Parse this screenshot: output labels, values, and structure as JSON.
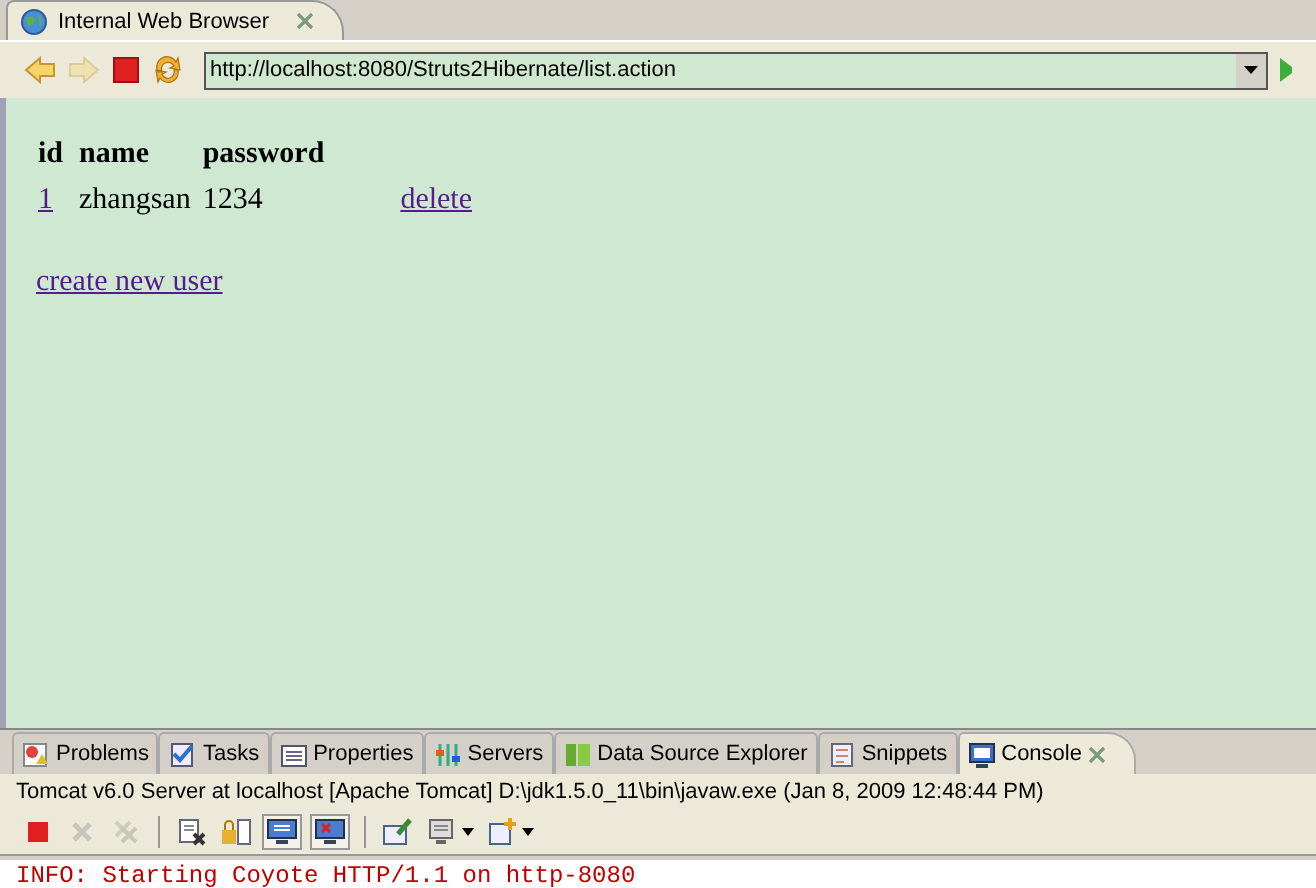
{
  "editor_tab": {
    "title": "Internal Web Browser",
    "selected": true
  },
  "browser_toolbar": [
    {
      "kind": "back",
      "disabled": false
    },
    {
      "kind": "forward",
      "disabled": true
    },
    {
      "kind": "stop",
      "disabled": false
    },
    {
      "kind": "refresh",
      "disabled": false
    }
  ],
  "address": {
    "value": "http://localhost:8080/Struts2Hibernate/list.action"
  },
  "page": {
    "table": {
      "columns": [
        "id",
        "name",
        "password"
      ],
      "rows": [
        {
          "id": "1",
          "name": "zhangsan",
          "password": "1234",
          "action": "delete"
        }
      ]
    },
    "create_link": "create new user"
  },
  "bottom_tabs": [
    {
      "label": "Problems",
      "selected": false
    },
    {
      "label": "Tasks",
      "selected": false
    },
    {
      "label": "Properties",
      "selected": false
    },
    {
      "label": "Servers",
      "selected": false
    },
    {
      "label": "Data Source Explorer",
      "selected": false
    },
    {
      "label": "Snippets",
      "selected": false
    },
    {
      "label": "Console",
      "selected": true
    }
  ],
  "console": {
    "title": "Tomcat v6.0 Server at localhost [Apache Tomcat] D:\\jdk1.5.0_11\\bin\\javaw.exe (Jan 8, 2009 12:48:44 PM)",
    "toolbar": [
      {
        "kind": "terminate",
        "disabled": false,
        "selected": false
      },
      {
        "kind": "remove",
        "disabled": true,
        "selected": false
      },
      {
        "kind": "remove-all",
        "disabled": true,
        "selected": false
      },
      {
        "kind": "separator"
      },
      {
        "kind": "clear",
        "disabled": false,
        "selected": false
      },
      {
        "kind": "scroll-lock",
        "disabled": false,
        "selected": false
      },
      {
        "kind": "stdout",
        "disabled": false,
        "selected": true
      },
      {
        "kind": "stderr",
        "disabled": false,
        "selected": true
      },
      {
        "kind": "separator"
      },
      {
        "kind": "pin",
        "disabled": false,
        "selected": false
      },
      {
        "kind": "display",
        "disabled": false,
        "selected": false,
        "dropdown": true
      },
      {
        "kind": "new-console",
        "disabled": false,
        "selected": false,
        "dropdown": true
      }
    ],
    "lines": [
      "INFO: Starting Coyote HTTP/1.1 on http-8080"
    ]
  }
}
